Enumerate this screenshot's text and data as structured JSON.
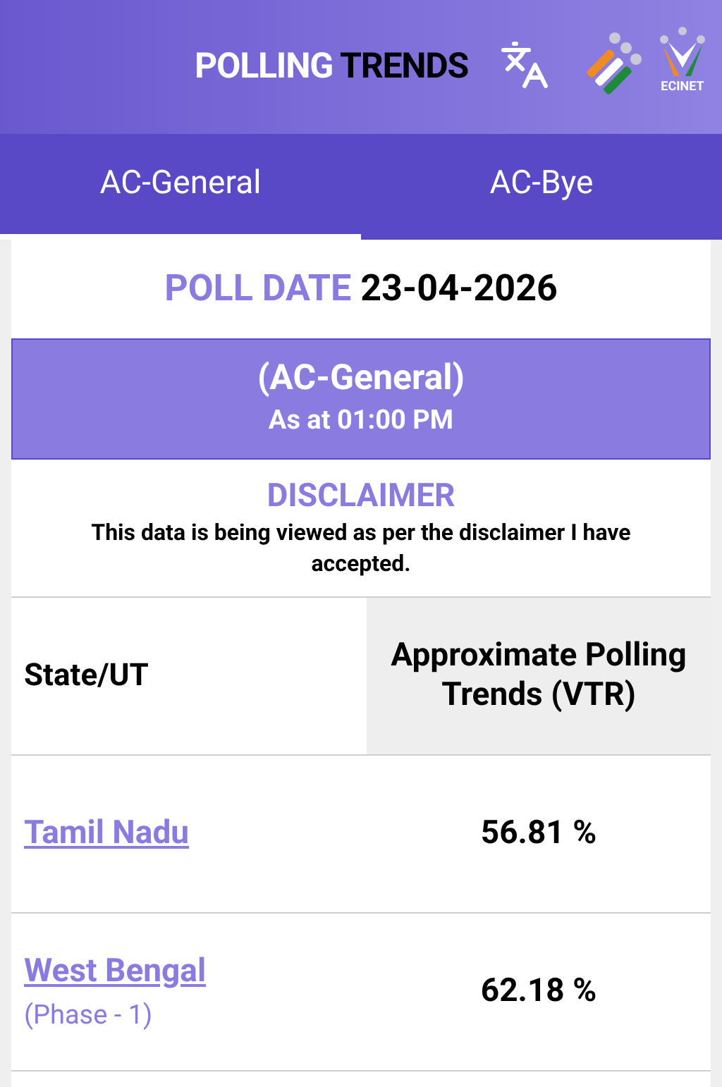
{
  "header": {
    "title_part_1": "POLLING ",
    "title_part_2": "TRENDS",
    "logo_caption": "ECINET"
  },
  "tabs": [
    {
      "label": "AC-General",
      "selected": true
    },
    {
      "label": "AC-Bye",
      "selected": false
    }
  ],
  "poll_date": {
    "label": "POLL DATE",
    "value": "23-04-2026"
  },
  "banner": {
    "title": "(AC-General)",
    "subtitle": "As at 01:00 PM"
  },
  "disclaimer": {
    "title": "DISCLAIMER",
    "text": "This data is being viewed as per the disclaimer I have accepted."
  },
  "table": {
    "columns": [
      "State/UT",
      "Approximate Polling Trends (VTR)"
    ],
    "rows": [
      {
        "state": "Tamil Nadu",
        "value": "56.81 %"
      },
      {
        "state": "West Bengal",
        "note": "(Phase - 1)",
        "value": "62.18 %"
      }
    ]
  }
}
